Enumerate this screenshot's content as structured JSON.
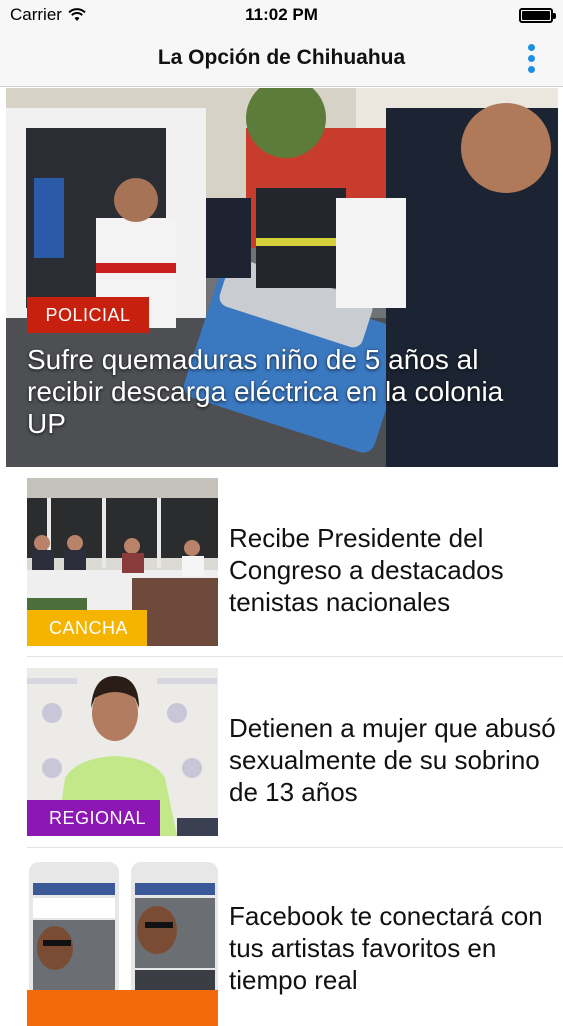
{
  "status_bar": {
    "carrier": "Carrier",
    "time": "11:02 PM"
  },
  "nav": {
    "title": "La Opción de Chihuahua"
  },
  "hero": {
    "category": "POLICIAL",
    "category_color": "#c8200f",
    "title": "Sufre quemaduras niño de 5 años al recibir descarga eléctrica en la colonia UP"
  },
  "articles": [
    {
      "category": "CANCHA",
      "category_color": "#f5b400",
      "title": "Recibe Presidente del Congreso a destacados tenistas nacionales"
    },
    {
      "category": "REGIONAL",
      "category_color": "#8d17b5",
      "title": "Detienen a mujer que abusó sexualmente de su sobrino de 13 años"
    },
    {
      "category": "",
      "category_color": "#f26a0a",
      "title": "Facebook te conectará con tus artistas favoritos en tiempo real"
    }
  ]
}
